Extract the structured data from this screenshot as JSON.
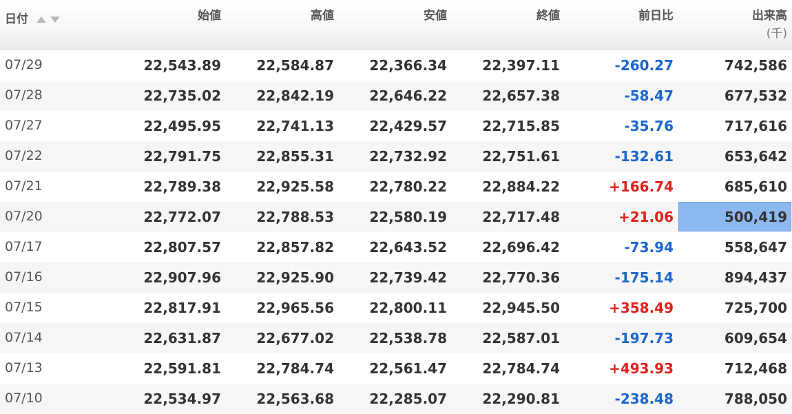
{
  "header": {
    "date": "日付",
    "open": "始値",
    "high": "高値",
    "low": "安値",
    "close": "終値",
    "change": "前日比",
    "volume": "出来高",
    "volume_unit": "(千)"
  },
  "colors": {
    "negative": "#1a66cc",
    "positive": "#e0201b",
    "selected_cell": "#8cb8f0",
    "alt_row": "#f6f6f6"
  },
  "rows": [
    {
      "date": "07/29",
      "open": "22,543.89",
      "high": "22,584.87",
      "low": "22,366.34",
      "close": "22,397.11",
      "change": "-260.27",
      "volume": "742,586"
    },
    {
      "date": "07/28",
      "open": "22,735.02",
      "high": "22,842.19",
      "low": "22,646.22",
      "close": "22,657.38",
      "change": "-58.47",
      "volume": "677,532"
    },
    {
      "date": "07/27",
      "open": "22,495.95",
      "high": "22,741.13",
      "low": "22,429.57",
      "close": "22,715.85",
      "change": "-35.76",
      "volume": "717,616"
    },
    {
      "date": "07/22",
      "open": "22,791.75",
      "high": "22,855.31",
      "low": "22,732.92",
      "close": "22,751.61",
      "change": "-132.61",
      "volume": "653,642"
    },
    {
      "date": "07/21",
      "open": "22,789.38",
      "high": "22,925.58",
      "low": "22,780.22",
      "close": "22,884.22",
      "change": "+166.74",
      "volume": "685,610"
    },
    {
      "date": "07/20",
      "open": "22,772.07",
      "high": "22,788.53",
      "low": "22,580.19",
      "close": "22,717.48",
      "change": "+21.06",
      "volume": "500,419"
    },
    {
      "date": "07/17",
      "open": "22,807.57",
      "high": "22,857.82",
      "low": "22,643.52",
      "close": "22,696.42",
      "change": "-73.94",
      "volume": "558,647"
    },
    {
      "date": "07/16",
      "open": "22,907.96",
      "high": "22,925.90",
      "low": "22,739.42",
      "close": "22,770.36",
      "change": "-175.14",
      "volume": "894,437"
    },
    {
      "date": "07/15",
      "open": "22,817.91",
      "high": "22,965.56",
      "low": "22,800.11",
      "close": "22,945.50",
      "change": "+358.49",
      "volume": "725,700"
    },
    {
      "date": "07/14",
      "open": "22,631.87",
      "high": "22,677.02",
      "low": "22,538.78",
      "close": "22,587.01",
      "change": "-197.73",
      "volume": "609,654"
    },
    {
      "date": "07/13",
      "open": "22,591.81",
      "high": "22,784.74",
      "low": "22,561.47",
      "close": "22,784.74",
      "change": "+493.93",
      "volume": "712,468"
    },
    {
      "date": "07/10",
      "open": "22,534.97",
      "high": "22,563.68",
      "low": "22,285.07",
      "close": "22,290.81",
      "change": "-238.48",
      "volume": "788,050"
    }
  ]
}
